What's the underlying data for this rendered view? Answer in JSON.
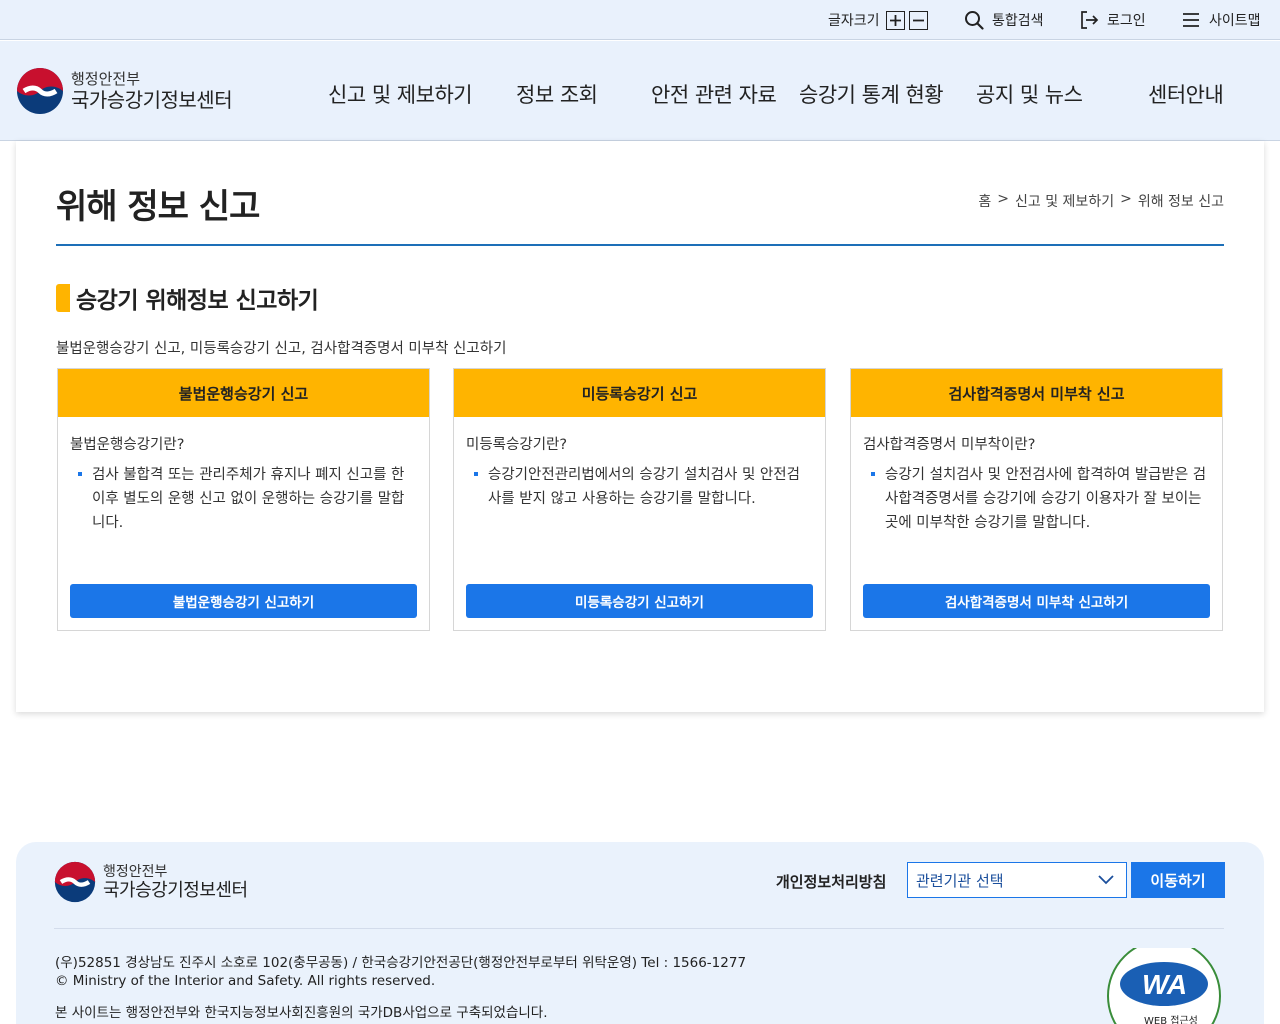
{
  "utility": {
    "font_size_label": "글자크기",
    "search_label": "통합검색",
    "login_label": "로그인",
    "sitemap_label": "사이트맵"
  },
  "header": {
    "logo_sub": "행정안전부",
    "logo_main": "국가승강기정보센터",
    "nav": [
      "신고 및 제보하기",
      "정보 조회",
      "안전 관련 자료",
      "승강기 통계 현황",
      "공지 및 뉴스",
      "센터안내"
    ]
  },
  "page": {
    "title": "위해 정보 신고",
    "breadcrumb": [
      "홈",
      ">",
      "신고 및 제보하기",
      ">",
      "위해 정보 신고"
    ],
    "section_title": "승강기 위해정보 신고하기",
    "section_desc": "불법운행승강기 신고, 미등록승강기 신고, 검사합격증명서 미부착 신고하기",
    "boxes": [
      {
        "heading": "불법운행승강기 신고",
        "question": "불법운행승강기란?",
        "desc": "검사 불합격 또는 관리주체가 휴지나 폐지 신고를 한 이후 별도의 운행 신고 없이 운행하는 승강기를 말합니다.",
        "button": "불법운행승강기 신고하기"
      },
      {
        "heading": "미등록승강기 신고",
        "question": "미등록승강기란?",
        "desc": "승강기안전관리법에서의 승강기 설치검사 및 안전검사를 받지 않고 사용하는 승강기를 말합니다.",
        "button": "미등록승강기 신고하기"
      },
      {
        "heading": "검사합격증명서 미부착 신고",
        "question": "검사합격증명서 미부착이란?",
        "desc": "승강기 설치검사 및 안전검사에 합격하여 발급받은 검사합격증명서를 승강기에 승강기 이용자가 잘 보이는 곳에 미부착한 승강기를 말합니다.",
        "button": "검사합격증명서 미부착 신고하기"
      }
    ]
  },
  "footer": {
    "logo_sub": "행정안전부",
    "logo_main": "국가승강기정보센터",
    "privacy": "개인정보처리방침",
    "select_value": "관련기관 선택",
    "go_button": "이동하기",
    "address": "(우)52851 경상남도 진주시 소호로 102(충무공동) / 한국승강기안전공단(행정안전부로부터 위탁운영) Tel : 1566-1277",
    "copyright": "© Ministry of the Interior and Safety. All rights reserved.",
    "notice": "본 사이트는 행정안전부와 한국지능정보사회진흥원의 국가DB사업으로 구축되었습니다.",
    "wa_text": "WA",
    "wa_sub": "WEB 접근성"
  },
  "colors": {
    "accent_blue": "#1b76e8",
    "accent_yellow": "#ffb400",
    "header_bg": "#e9f1fc",
    "title_rule": "#1d6fb8"
  }
}
